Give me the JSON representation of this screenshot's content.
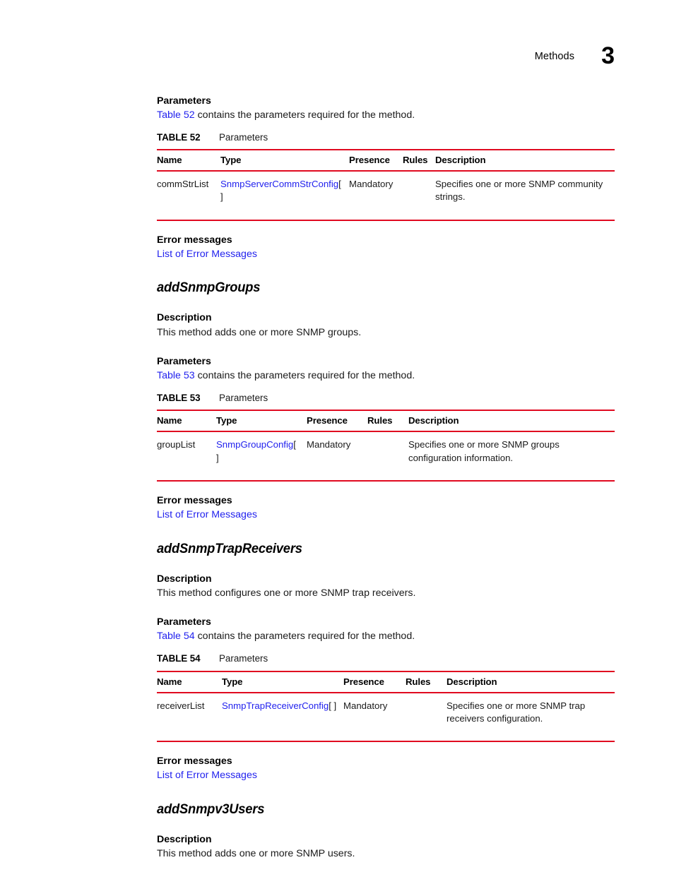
{
  "header": {
    "chapter_label": "Methods",
    "chapter_number": "3"
  },
  "colors": {
    "rule_red": "#e00a20",
    "link_blue": "#2222ee",
    "text_black": "#000000"
  },
  "labels": {
    "parameters_heading": "Parameters",
    "description_heading": "Description",
    "error_messages_heading": "Error messages",
    "error_messages_link": "List of Error Messages",
    "caption_title": "Parameters"
  },
  "sections": [
    {
      "id": "addSnmpCommunityStrings",
      "show_method_head": false,
      "method_head": "",
      "description": "",
      "parameters_intro_link": "Table 52",
      "parameters_intro_rest": " contains the parameters required for the method.",
      "table": {
        "caption_label": "TABLE 52",
        "caption_title": "Parameters",
        "columns": [
          "Name",
          "Type",
          "Presence",
          "Rules",
          "Description"
        ],
        "col_widths": [
          "90px",
          "182px",
          "76px",
          "46px",
          "254px"
        ],
        "rows": [
          {
            "name": "commStrList",
            "type_link": "SnmpServerCommStrConfig",
            "type_brackets": "[ ]",
            "presence": "Mandatory",
            "rules": "",
            "description": "Specifies one or more SNMP community strings."
          }
        ]
      }
    },
    {
      "id": "addSnmpGroups",
      "show_method_head": true,
      "method_head": "addSnmpGroups",
      "description": "This method adds one or more SNMP groups.",
      "parameters_intro_link": "Table 53",
      "parameters_intro_rest": " contains the parameters required for the method.",
      "table": {
        "caption_label": "TABLE 53",
        "caption_title": "Parameters",
        "columns": [
          "Name",
          "Type",
          "Presence",
          "Rules",
          "Description"
        ],
        "col_widths": [
          "84px",
          "128px",
          "86px",
          "58px",
          "292px"
        ],
        "rows": [
          {
            "name": "groupList",
            "type_link": "SnmpGroupConfig",
            "type_brackets": "[ ]",
            "presence": "Mandatory",
            "rules": "",
            "description": "Specifies one or more SNMP groups configuration information."
          }
        ]
      }
    },
    {
      "id": "addSnmpTrapReceivers",
      "show_method_head": true,
      "method_head": "addSnmpTrapReceivers",
      "description": "This method configures one or more SNMP trap receivers.",
      "parameters_intro_link": "Table 54",
      "parameters_intro_rest": " contains the parameters required for the method.",
      "table": {
        "caption_label": "TABLE 54",
        "caption_title": "Parameters",
        "columns": [
          "Name",
          "Type",
          "Presence",
          "Rules",
          "Description"
        ],
        "col_widths": [
          "92px",
          "172px",
          "88px",
          "58px",
          "238px"
        ],
        "rows": [
          {
            "name": "receiverList",
            "type_link": "SnmpTrapReceiverConfig",
            "type_brackets": "[ ]",
            "presence": "Mandatory",
            "rules": "",
            "description": "Specifies one or more SNMP trap receivers configuration."
          }
        ]
      }
    },
    {
      "id": "addSnmpv3Users",
      "show_method_head": true,
      "method_head": "addSnmpv3Users",
      "description": "This method adds one or more SNMP users.",
      "parameters_intro_link": "",
      "parameters_intro_rest": "",
      "table": null
    }
  ]
}
